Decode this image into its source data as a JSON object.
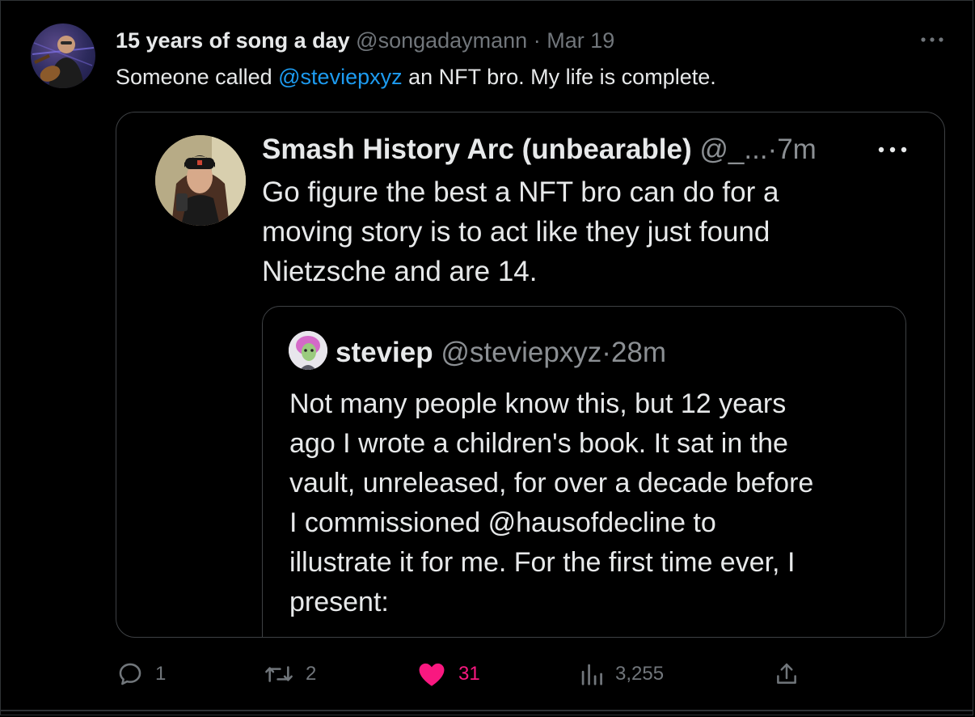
{
  "tweet": {
    "author_name": "15 years of song a day",
    "handle": "@songadaymann",
    "separator": "·",
    "time": "Mar 19",
    "text_before": "Someone called ",
    "mention": "@steviepxyz",
    "text_after": " an NFT bro. My life is complete.",
    "more_icon": "more-horizontal-icon"
  },
  "quoted_tweet": {
    "author_name": "Smash History Arc (unbearable)",
    "handle": "@_...",
    "separator": "·",
    "time": "7m",
    "text": "Go figure the best a NFT bro can do for a\nmoving story is to act like they just found\nNietzsche and are 14.",
    "more_icon": "more-horizontal-icon"
  },
  "nested_quoted_tweet": {
    "author_name": "steviep",
    "handle": "@steviepxyz",
    "separator": "·",
    "time": "28m",
    "text": "Not many people know this, but 12 years\nago I wrote a children's book. It sat in the\nvault, unreleased, for over a decade before\nI commissioned @hausofdecline to\nillustrate it for me. For the first time ever, I\npresent:"
  },
  "actions": {
    "replies": "1",
    "retweets": "2",
    "likes": "31",
    "views": "3,255"
  },
  "colors": {
    "background": "#000000",
    "text": "#e7e9ea",
    "muted": "#71767b",
    "link": "#1d9bf0",
    "like": "#f91880",
    "border": "#2f3336"
  }
}
